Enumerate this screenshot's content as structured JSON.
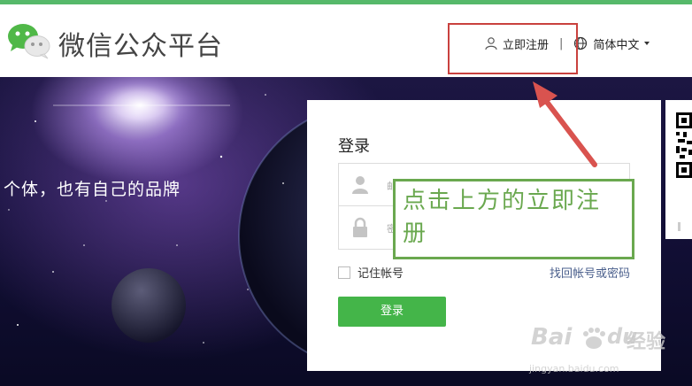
{
  "header": {
    "title": "微信公众平台",
    "register_label": "立即注册",
    "separator": "|",
    "language_label": "简体中文"
  },
  "banner": {
    "slogan": "个体，也有自己的品牌"
  },
  "login": {
    "title": "登录",
    "account_placeholder": "邮",
    "password_placeholder": "密",
    "remember_label": "记住帐号",
    "forgot_label": "找回帐号或密码",
    "submit_label": "登录"
  },
  "annotation": {
    "text": "点击上方的立即注册"
  },
  "watermark": {
    "brand": "Bai",
    "brand_cn": "经验",
    "url": "jingyan.baidu.com"
  },
  "colors": {
    "brand_green": "#44b549",
    "top_line": "#56b96a",
    "highlight_red": "#c9413e",
    "annotation_green": "#6aa84f"
  },
  "icons": [
    "wechat-logo",
    "user-icon",
    "globe-icon",
    "caret-down-icon",
    "lock-icon",
    "arrow",
    "qr-code"
  ]
}
